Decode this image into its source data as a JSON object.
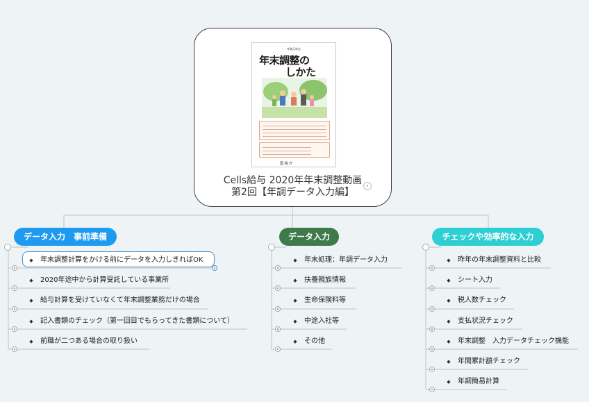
{
  "root": {
    "title_line1": "Cells給与 2020年年末調整動画",
    "title_line2": "第2回【年調データ入力編】",
    "cover": {
      "top_text": "令和元年分",
      "title_line1": "年末調整の",
      "title_line2": "しかた",
      "publisher": "国 税 庁"
    }
  },
  "branches": [
    {
      "label": "データ入力　事前準備",
      "color": "#1e9bf0",
      "items": [
        "年末調整計算をかける前にデータを入力しきればOK",
        "2020年途中から計算受託している事業所",
        "給与計算を受けていなくて年末調整業務だけの場合",
        "記入書類のチェック（第一回目でもらってきた書類について）",
        "前職が二つある場合の取り扱い"
      ]
    },
    {
      "label": "データ入力",
      "color": "#3f7a4a",
      "items": [
        "年末処理：年調データ入力",
        "扶養親族情報",
        "生命保険料等",
        "中途入社等",
        "その他"
      ]
    },
    {
      "label": "チェックや効率的な入力",
      "color": "#2dcfd3",
      "items": [
        "昨年の年末調整資料と比較",
        "シート入力",
        "税人数チェック",
        "支払状況チェック",
        "年末調整　入力データチェック機能",
        "年間累計額チェック",
        "年調簡易計算"
      ]
    }
  ]
}
